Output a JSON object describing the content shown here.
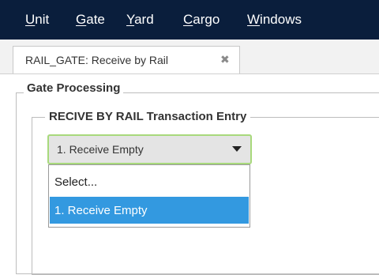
{
  "menubar": {
    "items": [
      {
        "mnemonic": "U",
        "rest": "nit"
      },
      {
        "mnemonic": "G",
        "rest": "ate"
      },
      {
        "mnemonic": "Y",
        "rest": "ard"
      },
      {
        "mnemonic": "C",
        "rest": "argo"
      },
      {
        "mnemonic": "W",
        "rest": "indows"
      }
    ]
  },
  "tab": {
    "label": "RAIL_GATE: Receive by Rail",
    "close_glyph": "✖"
  },
  "gate_processing": {
    "title": "Gate Processing",
    "entry": {
      "title": "RECIVE BY RAIL Transaction Entry",
      "select": {
        "value": "1. Receive Empty",
        "options": [
          "Select...",
          "1. Receive Empty"
        ],
        "highlighted": "1. Receive Empty"
      }
    }
  },
  "colors": {
    "menubar": "#0a1e3c",
    "select_focus_border": "#a8d97c",
    "option_highlight": "#3399e0"
  }
}
